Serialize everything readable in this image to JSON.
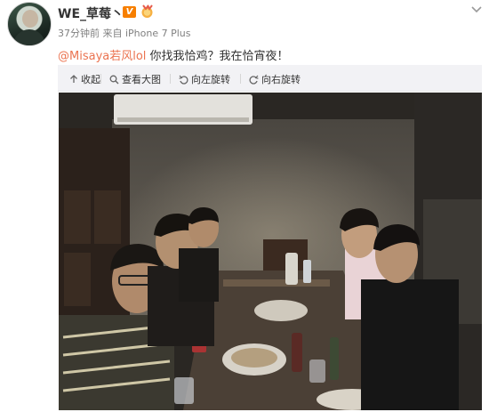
{
  "post": {
    "username": "WE_草莓丶",
    "vip_badge": "V",
    "meta": "37分钟前 来自 iPhone 7 Plus",
    "mention": "@Misaya若风lol",
    "text": " 你找我恰鸡？我在恰宵夜！"
  },
  "toolbar": {
    "collapse_label": "收起",
    "view_large_label": "查看大图",
    "rotate_left_label": "向左旋转",
    "rotate_right_label": "向右旋转"
  },
  "icons": {
    "vip": "vip-badge-icon",
    "medal": "medal-icon",
    "dropdown": "chevron-down-icon",
    "collapse": "arrow-up-icon",
    "view_large": "magnifier-icon",
    "rotate_left": "rotate-left-icon",
    "rotate_right": "rotate-right-icon"
  },
  "colors": {
    "mention": "#eb7350",
    "vip": "#f77f00",
    "meta": "#808080",
    "toolbar_bg": "#f2f2f5"
  }
}
